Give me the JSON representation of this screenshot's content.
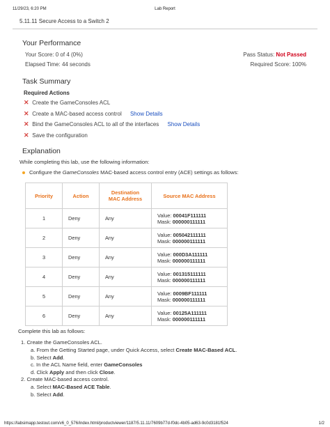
{
  "print_header": {
    "date": "11/29/23, 6:20 PM",
    "title": "Lab Report"
  },
  "lab_title": "5.11.11 Secure Access to a Switch 2",
  "performance": {
    "heading": "Your Performance",
    "score_label": "Your Score:",
    "score_value": "0 of 4 (0%)",
    "pass_label": "Pass Status:",
    "pass_value": "Not Passed",
    "elapsed_label": "Elapsed Time:",
    "elapsed_value": "44 seconds",
    "required_label": "Required Score:",
    "required_value": "100%"
  },
  "task_summary": {
    "heading": "Task Summary",
    "required_title": "Required Actions",
    "actions": [
      {
        "text": "Create the GameConsoles ACL",
        "link": ""
      },
      {
        "text": "Create a MAC-based access control",
        "link": "Show Details"
      },
      {
        "text": "Bind the GameConsoles ACL to all of the interfaces",
        "link": "Show Details"
      },
      {
        "text": "Save the configuration",
        "link": ""
      }
    ],
    "fail_icon": "✕",
    "colors": {
      "fail": "#d64541",
      "link": "#1a4fbf",
      "accent": "#e8711a"
    }
  },
  "explanation": {
    "heading": "Explanation",
    "intro": "While completing this lab, use the following information:",
    "bullet_pre": "Configure the ",
    "bullet_italic": "GameConsoles",
    "bullet_post": " MAC-based access control entry (ACE) settings as follows:",
    "table": {
      "headers": [
        "Priority",
        "Action",
        "Destination MAC Address",
        "Source MAC Address"
      ],
      "rows": [
        {
          "priority": "1",
          "action": "Deny",
          "dest": "Any",
          "value_label": "Value:",
          "value": "00041F111111",
          "mask_label": "Mask:",
          "mask": "000000111111"
        },
        {
          "priority": "2",
          "action": "Deny",
          "dest": "Any",
          "value_label": "Value:",
          "value": "005042111111",
          "mask_label": "Mask:",
          "mask": "000000111111"
        },
        {
          "priority": "3",
          "action": "Deny",
          "dest": "Any",
          "value_label": "Value:",
          "value": "000D3A111111",
          "mask_label": "Mask:",
          "mask": "000000111111"
        },
        {
          "priority": "4",
          "action": "Deny",
          "dest": "Any",
          "value_label": "Value:",
          "value": "001315111111",
          "mask_label": "Mask:",
          "mask": "000000111111"
        },
        {
          "priority": "5",
          "action": "Deny",
          "dest": "Any",
          "value_label": "Value:",
          "value": "0009BF111111",
          "mask_label": "Mask:",
          "mask": "000000111111"
        },
        {
          "priority": "6",
          "action": "Deny",
          "dest": "Any",
          "value_label": "Value:",
          "value": "00125A111111",
          "mask_label": "Mask:",
          "mask": "000000111111"
        }
      ]
    },
    "complete_intro": "Complete this lab as follows:",
    "step1": {
      "title": "1. Create the GameConsoles ACL.",
      "a_pre": "a. From the Getting Started page, under Quick Access, select ",
      "a_bold": "Create MAC-Based ACL",
      "a_post": ".",
      "b_pre": "b. Select ",
      "b_bold": "Add",
      "b_post": ".",
      "c_pre": "c. In the ACL Name field, enter ",
      "c_bold": "GameConsoles",
      "d_pre": "d. Click ",
      "d_bold1": "Apply",
      "d_mid": " and then click ",
      "d_bold2": "Close",
      "d_post": "."
    },
    "step2": {
      "title": "2. Create MAC-based access control.",
      "a_pre": "a. Select ",
      "a_bold": "MAC-Based ACE Table",
      "a_post": ".",
      "b_pre": "b. Select ",
      "b_bold": "Add",
      "b_post": "."
    }
  },
  "print_footer": {
    "url": "https://labsimapp.testout.com/v6_0_576/index.html/productviewer/1187/5.11.11/7609b77d-f0dc-4b05-ad63-9c0d3181f524",
    "page": "1/2"
  }
}
